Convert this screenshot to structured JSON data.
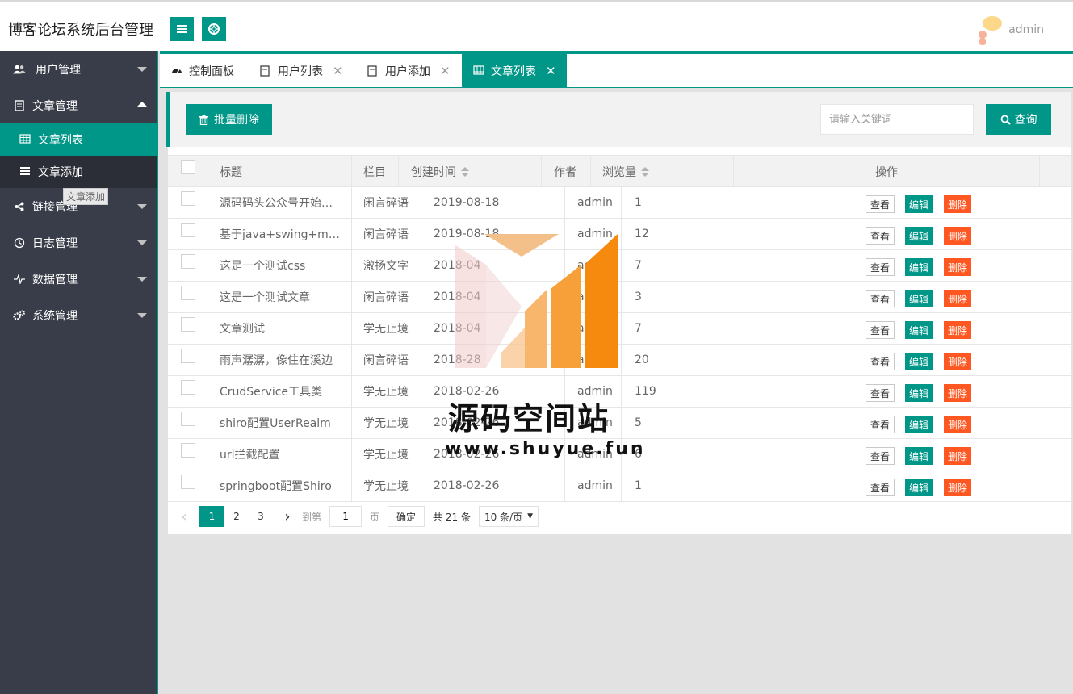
{
  "header": {
    "title": "博客论坛系统后台管理",
    "user": "admin"
  },
  "sidebar": {
    "items": [
      {
        "label": "用户管理",
        "icon": "users-icon"
      },
      {
        "label": "文章管理",
        "icon": "document-icon",
        "expanded": true
      },
      {
        "label": "链接管理",
        "icon": "share-icon"
      },
      {
        "label": "日志管理",
        "icon": "log-icon"
      },
      {
        "label": "数据管理",
        "icon": "pulse-icon"
      },
      {
        "label": "系统管理",
        "icon": "gears-icon"
      }
    ],
    "sub_items": [
      {
        "label": "文章列表",
        "icon": "table-icon",
        "active": true
      },
      {
        "label": "文章添加",
        "icon": "list-icon"
      }
    ],
    "tooltip": "文章添加"
  },
  "tabs": [
    {
      "label": "控制面板",
      "icon": "dashboard-icon"
    },
    {
      "label": "用户列表",
      "icon": "page-icon"
    },
    {
      "label": "用户添加",
      "icon": "page-icon"
    },
    {
      "label": "文章列表",
      "icon": "table-icon",
      "active": true
    }
  ],
  "toolbar": {
    "batch_delete": "批量删除",
    "search_placeholder": "请输入关键词",
    "search_button": "查询"
  },
  "table": {
    "columns": [
      "标题",
      "栏目",
      "创建时间",
      "作者",
      "浏览量",
      "操作"
    ],
    "actions": {
      "view": "查看",
      "edit": "编辑",
      "delete": "删除"
    },
    "rows": [
      {
        "title": "源码码头公众号开始运营了",
        "category": "闲言碎语",
        "date": "2019-08-18",
        "author": "admin",
        "views": "1"
      },
      {
        "title": "基于java+swing+mysql",
        "category": "闲言碎语",
        "date": "2019-08-18",
        "author": "admin",
        "views": "12"
      },
      {
        "title": "这是一个测试css",
        "category": "激扬文字",
        "date": "2018-04",
        "author": "admin",
        "views": "7"
      },
      {
        "title": "这是一个测试文章",
        "category": "闲言碎语",
        "date": "2018-04",
        "author": "admin",
        "views": "3"
      },
      {
        "title": "文章测试",
        "category": "学无止境",
        "date": "2018-04",
        "author": "admin",
        "views": "7"
      },
      {
        "title": "雨声潺潺，像住在溪边",
        "category": "闲言碎语",
        "date": "2018-28",
        "author": "admin",
        "views": "20"
      },
      {
        "title": "CrudService工具类",
        "category": "学无止境",
        "date": "2018-02-26",
        "author": "admin",
        "views": "119"
      },
      {
        "title": "shiro配置UserRealm",
        "category": "学无止境",
        "date": "2018-02-26",
        "author": "admin",
        "views": "5"
      },
      {
        "title": "url拦截配置",
        "category": "学无止境",
        "date": "2018-02-26",
        "author": "admin",
        "views": "6"
      },
      {
        "title": "springboot配置Shiro",
        "category": "学无止境",
        "date": "2018-02-26",
        "author": "admin",
        "views": "1"
      }
    ]
  },
  "pager": {
    "prev": "‹",
    "pages": [
      "1",
      "2",
      "3"
    ],
    "current": "1",
    "next": "›",
    "goto_label": "到第",
    "goto_value": "1",
    "page_unit": "页",
    "confirm": "确定",
    "total": "共 21 条",
    "page_size": "10 条/页"
  },
  "watermark": {
    "text": "源码空间站",
    "url": "www.shuyue.fun"
  },
  "colors": {
    "accent": "#009688",
    "danger": "#ff5722",
    "sidebar": "#393d49"
  }
}
